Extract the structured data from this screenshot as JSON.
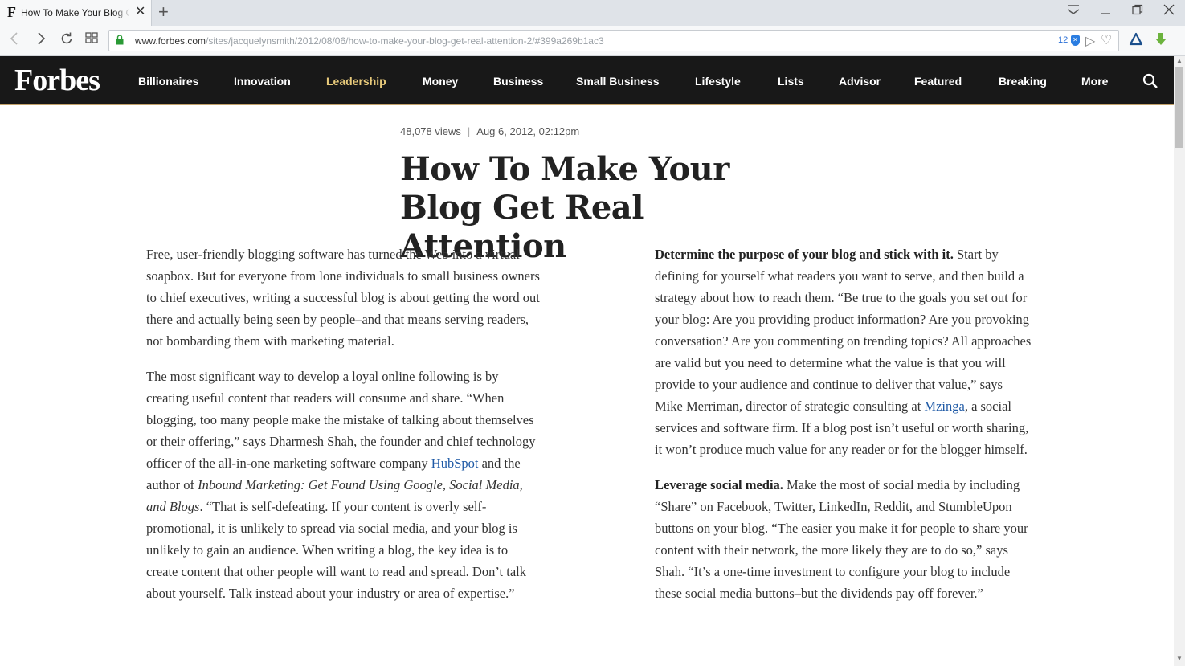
{
  "browser": {
    "tab_title": "How To Make Your Blog Get Real Attention",
    "tab_favicon": "F",
    "url_host": "www.forbes.com",
    "url_path": "/sites/jacquelynsmith/2012/08/06/how-to-make-your-blog-get-real-attention-2/#399a269b1ac3",
    "badge_count": "12",
    "icons": [
      "back-icon",
      "forward-icon",
      "reload-icon",
      "grid-icon",
      "lock-icon",
      "shield-icon",
      "send-icon",
      "heart-icon",
      "extension-icon",
      "download-icon",
      "menu-icon",
      "minimize-icon",
      "restore-icon",
      "close-icon"
    ]
  },
  "site": {
    "logo": "Forbes",
    "nav": [
      "Billionaires",
      "Innovation",
      "Leadership",
      "Money",
      "Business",
      "Small Business",
      "Lifestyle",
      "Lists",
      "Advisor",
      "Featured",
      "Breaking",
      "More"
    ],
    "active_nav": "Leadership",
    "accent_color": "#e7c97a",
    "nav_bg": "#181818"
  },
  "article": {
    "views": "48,078 views",
    "date": "Aug 6, 2012, 02:12pm",
    "title_line1": "How To Make Your",
    "title_line2": "Blog Get Real Attention",
    "left": {
      "p1": "Free, user-friendly blogging software has turned the Web into a virtual soapbox. But for everyone from lone individuals to small business owners to chief executives, writing a successful blog is about getting the word out there and actually being seen by people–and that means serving readers, not bombarding them with marketing material.",
      "p2_a": "The most significant way to develop a loyal online following is by creating useful content that readers will consume and share. “When blogging, too many people make the mistake of talking about themselves or their offering,” says Dharmesh Shah, the founder and chief technology officer of the all-in-one marketing software company ",
      "p2_link": "HubSpot",
      "p2_b": " and the author of ",
      "p2_italic": "Inbound Marketing: Get Found Using Google, Social Media, and Blogs",
      "p2_c": ". “That is self-defeating. If your content is overly self-promotional, it is unlikely to spread via social media, and your blog is unlikely to gain an audience. When writing a blog, the key idea is to create content that other people will want to read and spread. Don’t talk about yourself. Talk instead about your industry or area of expertise.”"
    },
    "right": {
      "p1_bold": "Determine the purpose of your blog and stick with it.",
      "p1_a": " Start by defining for yourself what readers you want to serve, and then build a strategy about how to reach them. “Be true to the goals you set out for your blog: Are you providing product information?  Are you provoking conversation?  Are you commenting on trending topics?  All approaches are valid but you need to determine what the value is that you will provide to your audience and continue to deliver that value,” says Mike Merriman, director of strategic consulting at ",
      "p1_link": "Mzinga",
      "p1_b": ", a social services and software firm.  If a blog post isn’t useful or worth sharing, it won’t produce much value for any reader or for the blogger himself.",
      "p2_bold": "Leverage social media.",
      "p2_a": " Make the most of social media by including “Share” on Facebook, Twitter, LinkedIn, Reddit, and StumbleUpon buttons on your blog. “The easier you make it for people to share your content with their network, the more likely they are to do so,” says Shah. “It’s a one-time investment to configure your blog to include these social media buttons–but the dividends pay off forever.”"
    }
  }
}
